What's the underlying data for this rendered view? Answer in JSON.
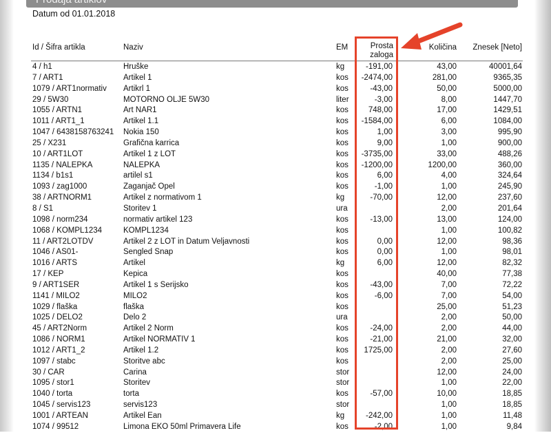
{
  "report": {
    "title": "Prodaja artiklov",
    "date_line": "Datum od 01.01.2018"
  },
  "columns": {
    "id": "Id / Šifra artikla",
    "name": "Naziv",
    "em": "EM",
    "stock_line1": "Prosta",
    "stock_line2": "zaloga",
    "qty": "Količina",
    "amount": "Znesek [Neto]"
  },
  "annotation": {
    "highlight_color": "#e5432a",
    "arrow": "red-arrow-icon"
  },
  "rows": [
    {
      "id": "4 / h1",
      "name": "Hruške",
      "em": "kg",
      "stock": "-191,00",
      "qty": "43,00",
      "amount": "40001,64"
    },
    {
      "id": "7 / ART1",
      "name": "Artikel 1",
      "em": "kos",
      "stock": "-2474,00",
      "qty": "281,00",
      "amount": "9365,35"
    },
    {
      "id": "1079 / ART1normativ",
      "name": "Artikrl 1",
      "em": "kos",
      "stock": "-43,00",
      "qty": "50,00",
      "amount": "5000,00"
    },
    {
      "id": "29 / 5W30",
      "name": "MOTORNO OLJE 5W30",
      "em": "liter",
      "stock": "-3,00",
      "qty": "8,00",
      "amount": "1447,70"
    },
    {
      "id": "1055 / ARTN1",
      "name": "Art NAR1",
      "em": "kos",
      "stock": "748,00",
      "qty": "17,00",
      "amount": "1429,51"
    },
    {
      "id": "1011 / ART1_1",
      "name": "Artikel 1.1",
      "em": "kos",
      "stock": "-1584,00",
      "qty": "6,00",
      "amount": "1084,00"
    },
    {
      "id": "1047 / 6438158763241",
      "name": "Nokia 150",
      "em": "kos",
      "stock": "1,00",
      "qty": "3,00",
      "amount": "995,90"
    },
    {
      "id": "25 / X231",
      "name": "Grafična karrica",
      "em": "kos",
      "stock": "9,00",
      "qty": "1,00",
      "amount": "900,00"
    },
    {
      "id": "10 / ART1LOT",
      "name": "Artikel 1 z LOT",
      "em": "kos",
      "stock": "-3735,00",
      "qty": "33,00",
      "amount": "488,26"
    },
    {
      "id": "1135 / NALEPKA",
      "name": "NALEPKA",
      "em": "kos",
      "stock": "-1200,00",
      "qty": "1200,00",
      "amount": "360,00"
    },
    {
      "id": "1134 / b1s1",
      "name": "artilel s1",
      "em": "kos",
      "stock": "6,00",
      "qty": "4,00",
      "amount": "324,64"
    },
    {
      "id": "1093 / zag1000",
      "name": "Zaganjač Opel",
      "em": "kos",
      "stock": "-1,00",
      "qty": "1,00",
      "amount": "245,90"
    },
    {
      "id": "38 / ARTNORM1",
      "name": "Artikel z normativom 1",
      "em": "kg",
      "stock": "-70,00",
      "qty": "12,00",
      "amount": "237,60"
    },
    {
      "id": "8 / S1",
      "name": "Storitev 1",
      "em": "ura",
      "stock": "",
      "qty": "2,00",
      "amount": "201,64"
    },
    {
      "id": "1098 / norm234",
      "name": "normativ artikel 123",
      "em": "kos",
      "stock": "-13,00",
      "qty": "13,00",
      "amount": "124,00"
    },
    {
      "id": "1068 / KOMPL1234",
      "name": "KOMPL1234",
      "em": "kos",
      "stock": "",
      "qty": "1,00",
      "amount": "100,82"
    },
    {
      "id": "11 / ART2LOTDV",
      "name": "Artikel 2 z LOT in Datum Veljavnosti",
      "em": "kos",
      "stock": "0,00",
      "qty": "12,00",
      "amount": "98,36"
    },
    {
      "id": "1046 / AS01-",
      "name": "Sengled Snap",
      "em": "kos",
      "stock": "0,00",
      "qty": "1,00",
      "amount": "98,01"
    },
    {
      "id": "1016 / ARTS",
      "name": "Artikel",
      "em": "kg",
      "stock": "6,00",
      "qty": "12,00",
      "amount": "82,32"
    },
    {
      "id": "17 / KEP",
      "name": "Kepica",
      "em": "kos",
      "stock": "",
      "qty": "40,00",
      "amount": "77,38"
    },
    {
      "id": "9 / ART1SER",
      "name": "Artikel 1 s Serijsko",
      "em": "kos",
      "stock": "-43,00",
      "qty": "7,00",
      "amount": "72,22"
    },
    {
      "id": "1141 / MILO2",
      "name": "MILO2",
      "em": "kos",
      "stock": "-6,00",
      "qty": "7,00",
      "amount": "54,00"
    },
    {
      "id": "1029 / flaška",
      "name": "flaška",
      "em": "kos",
      "stock": "",
      "qty": "25,00",
      "amount": "51,23"
    },
    {
      "id": "1025 / DELO2",
      "name": "Delo 2",
      "em": "ura",
      "stock": "",
      "qty": "2,00",
      "amount": "50,00"
    },
    {
      "id": "45 / ART2Norm",
      "name": "Artikel 2 Norm",
      "em": "kos",
      "stock": "-24,00",
      "qty": "2,00",
      "amount": "44,00"
    },
    {
      "id": "1086 / NORM1",
      "name": "Artikel NORMATIV 1",
      "em": "kos",
      "stock": "-21,00",
      "qty": "21,00",
      "amount": "32,00"
    },
    {
      "id": "1012 / ART1_2",
      "name": "Artikel 1.2",
      "em": "kos",
      "stock": "1725,00",
      "qty": "2,00",
      "amount": "27,60"
    },
    {
      "id": "1097 / stabc",
      "name": "Storitve abc",
      "em": "kos",
      "stock": "",
      "qty": "2,00",
      "amount": "25,00"
    },
    {
      "id": "30 / CAR",
      "name": "Carina",
      "em": "stor",
      "stock": "",
      "qty": "12,00",
      "amount": "24,00"
    },
    {
      "id": "1095 / stor1",
      "name": "Storitev",
      "em": "stor",
      "stock": "",
      "qty": "1,00",
      "amount": "22,00"
    },
    {
      "id": "1040 / torta",
      "name": "torta",
      "em": "kos",
      "stock": "-57,00",
      "qty": "10,00",
      "amount": "18,85"
    },
    {
      "id": "1045 / servis123",
      "name": "servis123",
      "em": "stor",
      "stock": "",
      "qty": "1,00",
      "amount": "18,85"
    },
    {
      "id": "1001 / ARTEAN",
      "name": "Artikel Ean",
      "em": "kg",
      "stock": "-242,00",
      "qty": "1,00",
      "amount": "11,48"
    },
    {
      "id": "1074 / 99512",
      "name": "Limona EKO 50ml Primavera Life",
      "em": "kos",
      "stock": "-2,00",
      "qty": "1,00",
      "amount": "9,84"
    }
  ]
}
